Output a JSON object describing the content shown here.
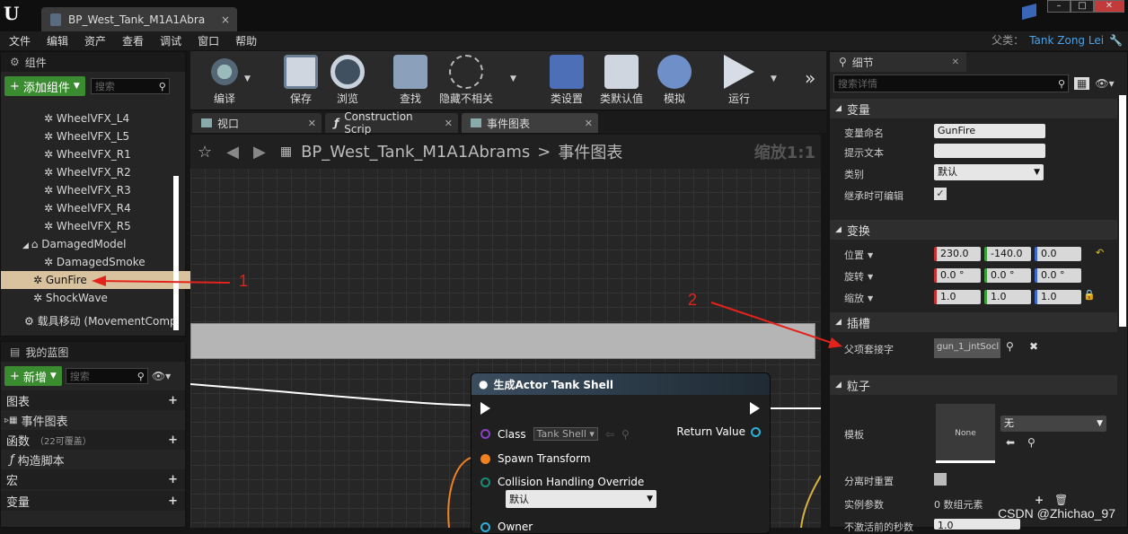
{
  "titlebar": {
    "doc_tab": "BP_West_Tank_M1A1Abra",
    "close": "×"
  },
  "menu": [
    "文件",
    "编辑",
    "资产",
    "查看",
    "调试",
    "窗口",
    "帮助"
  ],
  "parent_class": {
    "label": "父类：",
    "value": "Tank Zong Lei"
  },
  "components": {
    "tab": "组件",
    "add_button": "添加组件",
    "search_placeholder": "搜索",
    "items": [
      "WheelVFX_L4",
      "WheelVFX_L5",
      "WheelVFX_R1",
      "WheelVFX_R2",
      "WheelVFX_R3",
      "WheelVFX_R4",
      "WheelVFX_R5"
    ],
    "damaged_model": "DamagedModel",
    "damaged_smoke": "DamagedSmoke",
    "gunfire": "GunFire",
    "shockwave": "ShockWave",
    "movement": "载具移动 (MovementComp"
  },
  "blueprint": {
    "tab": "我的蓝图",
    "new_button": "新增",
    "search_placeholder": "搜索",
    "graphs": "图表",
    "event_graph": "事件图表",
    "functions": "函数",
    "functions_hint": "（22可覆盖）",
    "construction": "构造脚本",
    "macros": "宏",
    "variables": "变量"
  },
  "toolbar": {
    "compile": "编译",
    "save": "保存",
    "browse": "浏览",
    "find": "查找",
    "hide": "隐藏不相关",
    "class_settings": "类设置",
    "class_defaults": "类默认值",
    "simulate": "模拟",
    "play": "运行"
  },
  "editor_tabs": {
    "viewport": "视口",
    "construction": "Construction Scrip",
    "event_graph": "事件图表"
  },
  "breadcrumb": {
    "blueprint": "BP_West_Tank_M1A1Abrams",
    "sep": ">",
    "graph": "事件图表",
    "zoom": "缩放1:1"
  },
  "node": {
    "title": "生成Actor Tank Shell",
    "class_label": "Class",
    "class_value": "Tank Shell",
    "return_value": "Return Value",
    "spawn_transform": "Spawn Transform",
    "collision": "Collision Handling Override",
    "collision_value": "默认",
    "owner": "Owner"
  },
  "details": {
    "tab": "细节",
    "search_placeholder": "搜索详情",
    "variable_section": "变量",
    "var_name_label": "变量命名",
    "var_name": "GunFire",
    "tooltip_label": "提示文本",
    "category_label": "类别",
    "category_value": "默认",
    "instance_editable": "继承时可编辑",
    "transform_section": "变换",
    "location": "位置",
    "rotation": "旋转",
    "scale": "缩放",
    "loc": [
      "230.0",
      "-140.0",
      "0.0"
    ],
    "rot": [
      "0.0 °",
      "0.0 °",
      "0.0 °"
    ],
    "scl": [
      "1.0",
      "1.0",
      "1.0"
    ],
    "sockets_section": "插槽",
    "parent_socket": "父项套接字",
    "socket_value": "gun_1_jntSocl",
    "particles_section": "粒子",
    "template": "模板",
    "none_thumb": "None",
    "template_value": "无",
    "auto_destroy": "分离时重置",
    "instance_params": "实例参数",
    "instance_count": "0 数组元素",
    "seconds_label": "不激活前的秒数",
    "seconds_value": "1.0"
  },
  "annotations": {
    "one": "1",
    "two": "2"
  },
  "watermark": "CSDN @Zhichao_97",
  "colors": {
    "green": "#3b8c30",
    "selection": "#d9c39e",
    "red_annotation": "#e3231b",
    "pin_orange": "#f08020",
    "pin_cyan": "#2bb0d8"
  }
}
